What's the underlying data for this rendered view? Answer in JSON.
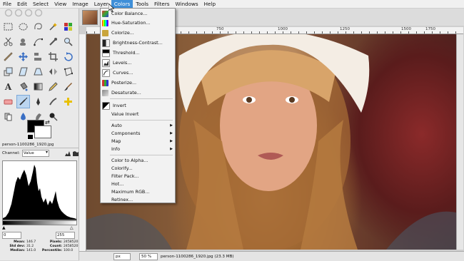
{
  "menubar": {
    "items": [
      "File",
      "Edit",
      "Select",
      "View",
      "Image",
      "Layer",
      "Colors",
      "Tools",
      "Filters",
      "Windows",
      "Help"
    ],
    "active": "Colors"
  },
  "colors_menu": {
    "group1": [
      {
        "label": "Color Balance...",
        "icon": "color-balance-icon"
      },
      {
        "label": "Hue-Saturation...",
        "icon": "hue-saturation-icon"
      },
      {
        "label": "Colorize...",
        "icon": "colorize-icon"
      },
      {
        "label": "Brightness-Contrast...",
        "icon": "brightness-contrast-icon"
      },
      {
        "label": "Threshold...",
        "icon": "threshold-icon"
      },
      {
        "label": "Levels...",
        "icon": "levels-icon"
      },
      {
        "label": "Curves...",
        "icon": "curves-icon"
      },
      {
        "label": "Posterize...",
        "icon": "posterize-icon"
      },
      {
        "label": "Desaturate...",
        "icon": "desaturate-icon"
      }
    ],
    "group2": [
      {
        "label": "Invert",
        "icon": "invert-icon"
      },
      {
        "label": "Value Invert",
        "icon": ""
      }
    ],
    "group3": [
      {
        "label": "Auto"
      },
      {
        "label": "Components"
      },
      {
        "label": "Map"
      },
      {
        "label": "Info"
      }
    ],
    "group4": [
      {
        "label": "Color to Alpha..."
      },
      {
        "label": "Colorify..."
      },
      {
        "label": "Filter Pack..."
      },
      {
        "label": "Hot..."
      },
      {
        "label": "Maximum RGB..."
      },
      {
        "label": "Retinex..."
      }
    ]
  },
  "histogram": {
    "file": "person-1100286_1920.jpg",
    "channel_label": "Channel:",
    "channel_value": "Value",
    "range_min": "0",
    "range_max": "255",
    "stats": [
      {
        "k1": "Mean:",
        "v1": "146.7",
        "k2": "Pixels:",
        "v2": "2458520"
      },
      {
        "k1": "Std dev:",
        "v1": "31.2",
        "k2": "Count:",
        "v2": "2458520"
      },
      {
        "k1": "Median:",
        "v1": "141.0",
        "k2": "Percentile:",
        "v2": "100.0"
      }
    ]
  },
  "ruler": {
    "ticks": [
      {
        "label": "750"
      },
      {
        "label": "1000"
      },
      {
        "label": "1250"
      },
      {
        "label": "1500"
      },
      {
        "label": "1750"
      }
    ]
  },
  "statusbar": {
    "unit": "px",
    "zoom": "50 %",
    "file_info": "person-1100286_1920.jpg (23.3 MB)"
  },
  "colors": {
    "menu_highlight": "#3f8fd8",
    "foreground": "#000000",
    "background": "#ffffff"
  }
}
